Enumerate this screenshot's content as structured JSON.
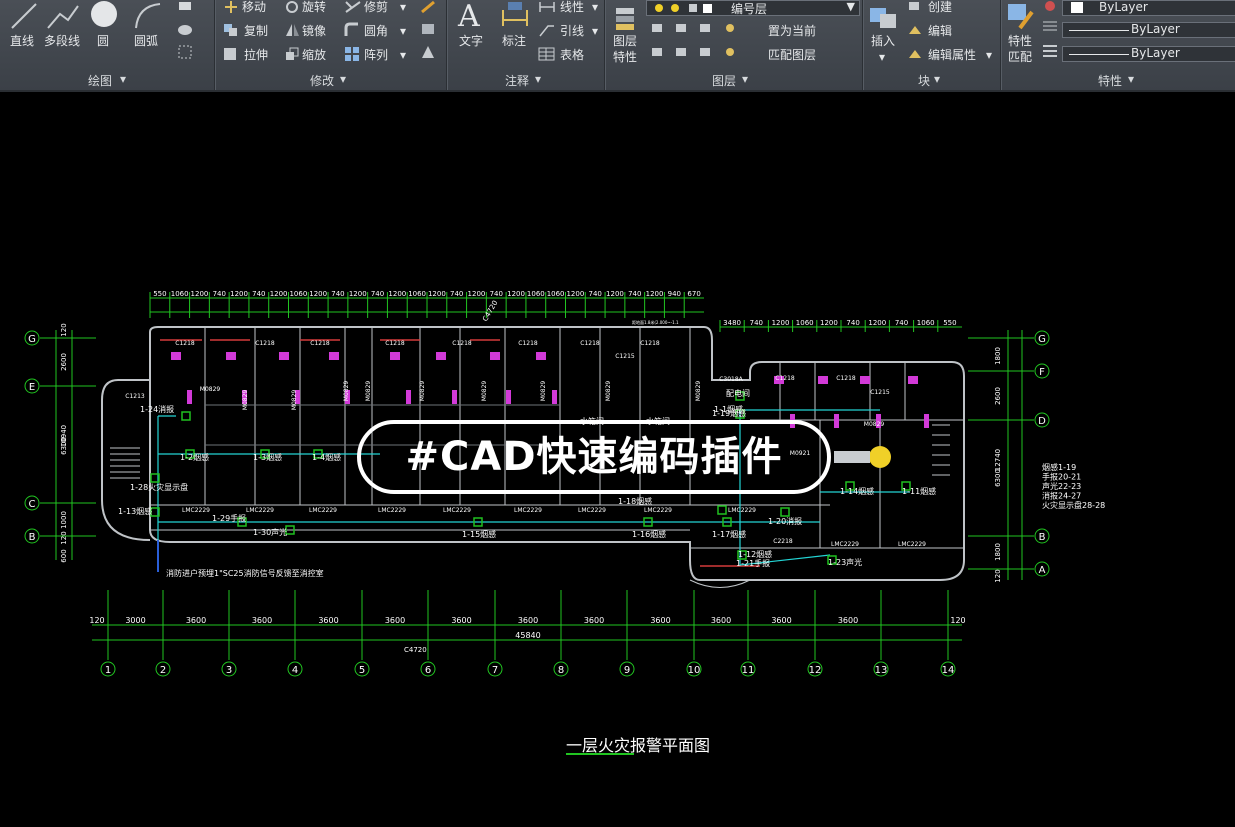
{
  "ribbon": {
    "draw_group": {
      "label": "绘图",
      "tools": [
        "直线",
        "多段线",
        "圆",
        "圆弧"
      ]
    },
    "modify_group": {
      "label": "修改",
      "tools": [
        "移动",
        "旋转",
        "修剪",
        "复制",
        "镜像",
        "圆角",
        "拉伸",
        "缩放",
        "阵列"
      ]
    },
    "annotate_group": {
      "label": "注释",
      "tools": [
        "文字",
        "标注",
        "线性",
        "引线",
        "表格"
      ]
    },
    "layer_group": {
      "label": "图层",
      "layer_props": "图层特性",
      "current_layer": "编号层",
      "set_current": "置为当前",
      "match_layer": "匹配图层"
    },
    "block_group": {
      "label": "块",
      "insert": "插入",
      "create": "创建",
      "edit": "编辑",
      "edit_attr": "编辑属性"
    },
    "props_group": {
      "label": "特性",
      "match_props": "特性匹配",
      "color": "ByLayer",
      "linetype": "ByLayer",
      "lineweight": "ByLayer"
    }
  },
  "drawing": {
    "overlay_badge": "#CAD快速编码插件",
    "title": "一层火灾报警平面图",
    "top_dims_left": [
      "550",
      "1060",
      "1200",
      "740",
      "1200",
      "740",
      "1200",
      "1060",
      "1200",
      "740",
      "1200",
      "740",
      "1200",
      "1060",
      "1200",
      "740",
      "1200",
      "740",
      "1200",
      "1060",
      "1060",
      "1200",
      "740",
      "1200",
      "740",
      "1200",
      "940",
      "670"
    ],
    "top_dims_right": [
      "3480",
      "740",
      "1200",
      "1060",
      "1200",
      "740",
      "1200",
      "740",
      "1060",
      "550"
    ],
    "bottom_dims": [
      "120",
      "3000",
      "3600",
      "3600",
      "3600",
      "3600",
      "3600",
      "3600",
      "3600",
      "3600",
      "3600",
      "3600",
      "3600",
      "120"
    ],
    "bottom_total": "45840",
    "left_dims": [
      "120",
      "2600",
      "10940",
      "6300",
      "1000",
      "120",
      "600"
    ],
    "right_dims": [
      "1800",
      "2600",
      "12740",
      "6300",
      "1800",
      "120"
    ],
    "axis_cols": [
      "1",
      "2",
      "3",
      "4",
      "5",
      "6",
      "7",
      "8",
      "9",
      "10",
      "11",
      "12",
      "13",
      "14"
    ],
    "axis_rows_left": [
      "G",
      "E",
      "C",
      "B"
    ],
    "axis_rows_right": [
      "G",
      "F",
      "D",
      "B",
      "A"
    ],
    "windows": [
      "C1218",
      "C1218",
      "C1218",
      "C1218",
      "C1218",
      "C1218",
      "C1218",
      "C1218",
      "C1215",
      "C1218",
      "C1218",
      "C1215",
      "C1213"
    ],
    "doors": [
      "M0829",
      "M0829",
      "M0829",
      "M0829",
      "M0829",
      "M0829",
      "M0829",
      "M0829",
      "M0829",
      "M0829",
      "M0921",
      "M0829",
      "C3018A",
      "C2218"
    ],
    "lmc": [
      "LMC2229",
      "LMC2229",
      "LMC2229",
      "LMC2229",
      "LMC2229",
      "LMC2229",
      "LMC2229",
      "LMC2229",
      "LMC2229",
      "LMC2229",
      "LMC2229"
    ],
    "devices": [
      "1-24消报",
      "1-2烟感",
      "1-3烟感",
      "1-4烟感",
      "1-28火灾显示盘",
      "1-13烟感",
      "1-29手报",
      "1-30声光",
      "1-15烟感",
      "1-16烟感",
      "1-17烟感",
      "1-18烟感",
      "1-20消报",
      "1-14烟感",
      "1-11烟感",
      "1-12烟感",
      "1-21手报",
      "1-23声光",
      "1-19烟感",
      "1-1烟感"
    ],
    "rooms": [
      "配电间",
      "水箱间",
      "水箱间"
    ],
    "legend": [
      "烟感1-19",
      "手报20-21",
      "声光22-23",
      "消报24-27",
      "火灾显示盘28-28"
    ],
    "note": "消防进户预埋1\"SC25消防信号反馈至消控室",
    "ceiling_labels": [
      "C4720",
      "C4720",
      "C4720"
    ],
    "ceiling_tag": "距地面1.8米(2.000~-1.1"
  },
  "colors": {
    "wall": "#bfc3c7",
    "axis": "#21c521",
    "dim": "#21c521",
    "wire": "#23d4d4",
    "device": "#20c020",
    "text": "#ffffff",
    "magenta": "#d23ad8",
    "red": "#d43a3a",
    "highlight": "#f0d028",
    "ribbon_bg": "#3f444b"
  }
}
